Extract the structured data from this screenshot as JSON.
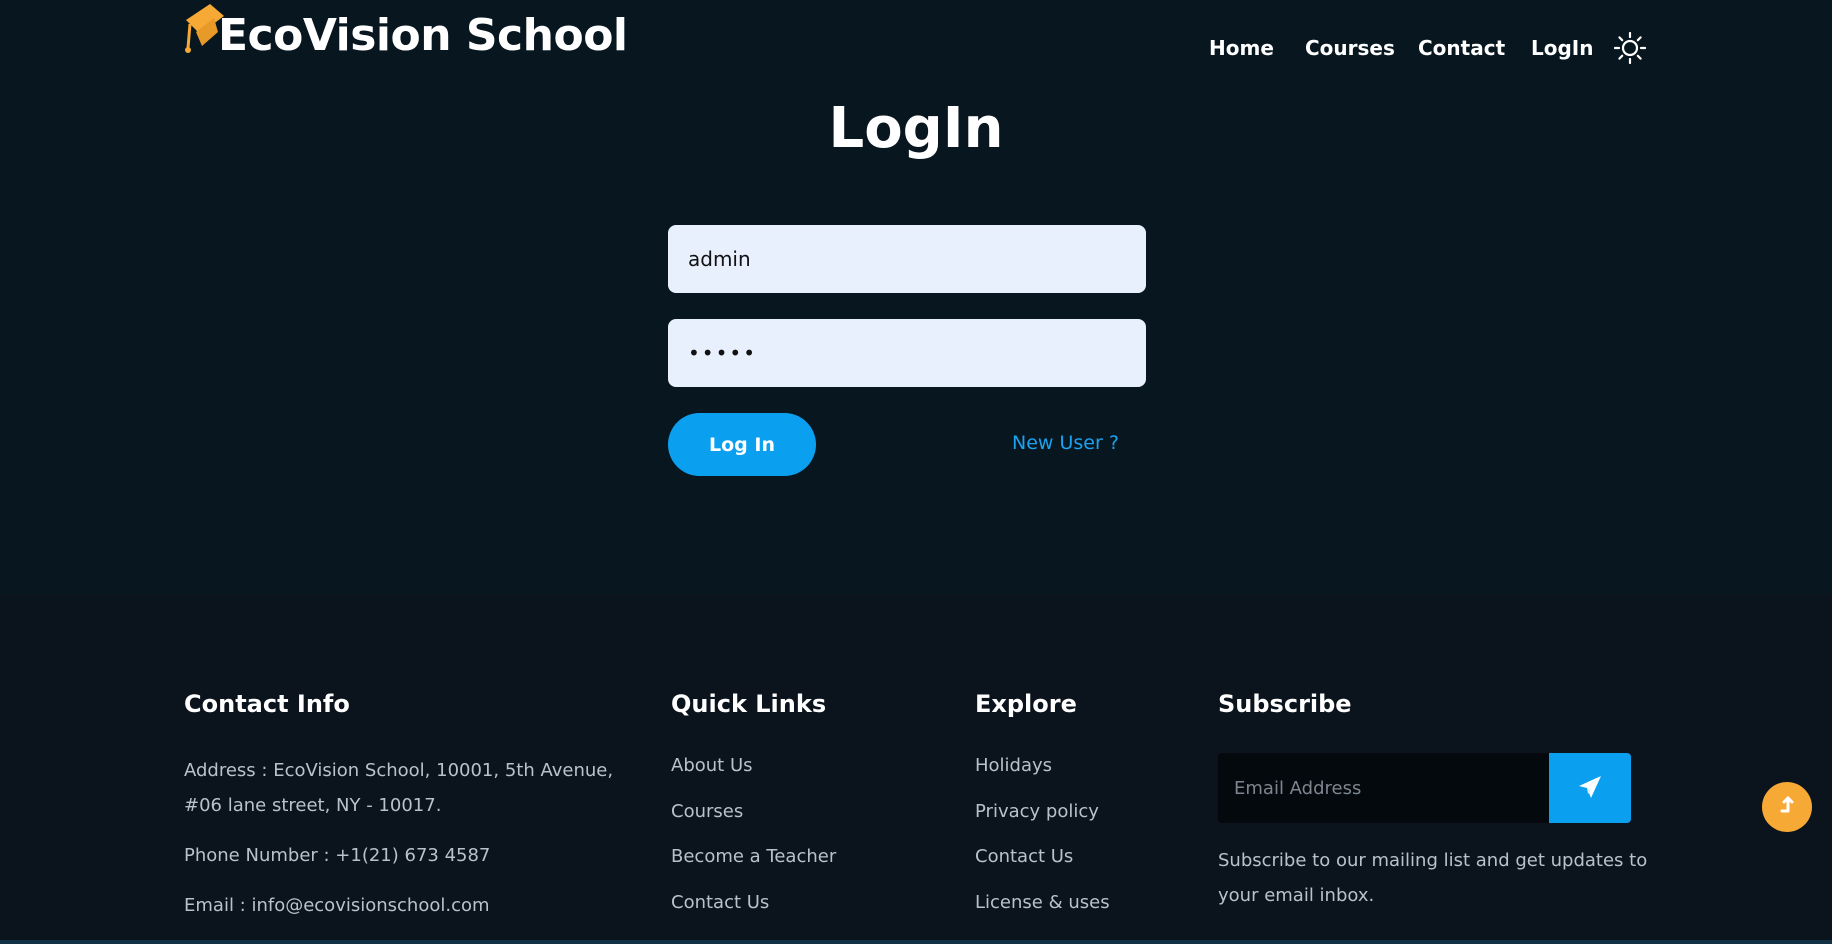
{
  "brand": {
    "name": "EcoVision School",
    "icon": "graduation-cap-icon",
    "icon_color": "#f7a935"
  },
  "nav": {
    "items": [
      "Home",
      "Courses",
      "Contact",
      "LogIn"
    ],
    "theme_icon": "sun-icon"
  },
  "login": {
    "title": "LogIn",
    "username_value": "admin",
    "password_value": "•••••",
    "submit_label": "Log In",
    "new_user_label": "New User ?"
  },
  "footer": {
    "contact": {
      "title": "Contact Info",
      "address_line1": "Address : EcoVision School, 10001, 5th Avenue,",
      "address_line2": "#06 lane street, NY - 10017.",
      "phone": "Phone Number : +1(21) 673 4587",
      "email": "Email : info@ecovisionschool.com"
    },
    "quick_links": {
      "title": "Quick Links",
      "items": [
        "About Us",
        "Courses",
        "Become a Teacher",
        "Contact Us"
      ]
    },
    "explore": {
      "title": "Explore",
      "items": [
        "Holidays",
        "Privacy policy",
        "Contact Us",
        "License & uses"
      ]
    },
    "subscribe": {
      "title": "Subscribe",
      "placeholder": "Email Address",
      "send_icon": "paper-plane-icon",
      "text_line1": "Subscribe to our mailing list and get updates to",
      "text_line2": "your email inbox."
    }
  },
  "scroll_top_icon": "arrow-up-icon",
  "colors": {
    "accent": "#0ba0ef",
    "brand_orange": "#f7a935",
    "background": "#081620",
    "footer_bg": "#0b131d",
    "field_bg": "#e8f0fe"
  }
}
